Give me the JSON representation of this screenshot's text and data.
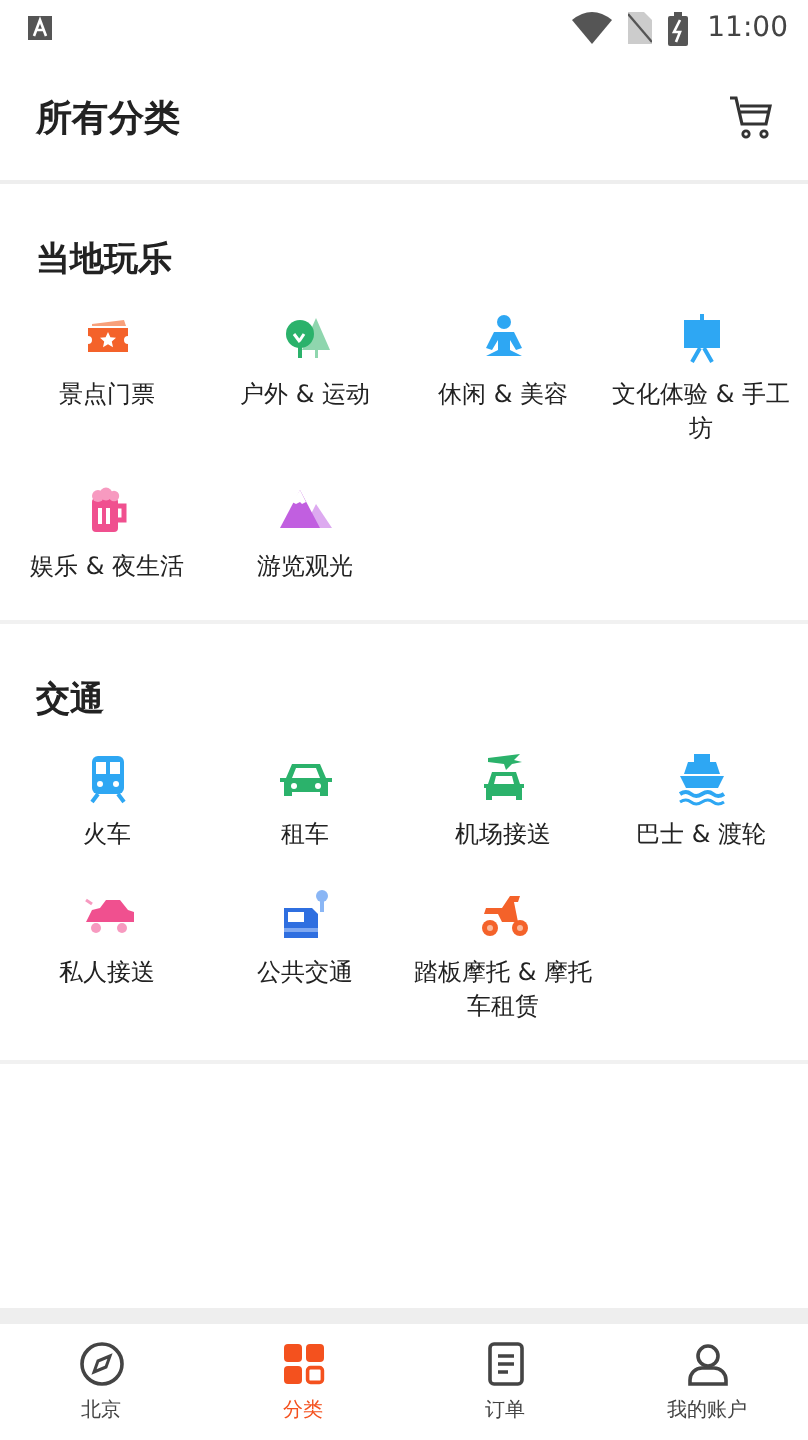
{
  "status_bar": {
    "time": "11:00"
  },
  "header": {
    "title": "所有分类"
  },
  "sections": [
    {
      "title": "当地玩乐",
      "items": [
        {
          "label": "景点门票"
        },
        {
          "label": "户外 & 运动"
        },
        {
          "label": "休闲 & 美容"
        },
        {
          "label": "文化体验 & 手工坊"
        },
        {
          "label": "娱乐 & 夜生活"
        },
        {
          "label": "游览观光"
        }
      ]
    },
    {
      "title": "交通",
      "items": [
        {
          "label": "火车"
        },
        {
          "label": "租车"
        },
        {
          "label": "机场接送"
        },
        {
          "label": "巴士 & 渡轮"
        },
        {
          "label": "私人接送"
        },
        {
          "label": "公共交通"
        },
        {
          "label": "踏板摩托 & 摩托车租赁"
        }
      ]
    }
  ],
  "tab_bar": [
    {
      "label": "北京",
      "selected": false
    },
    {
      "label": "分类",
      "selected": true
    },
    {
      "label": "订单",
      "selected": false
    },
    {
      "label": "我的账户",
      "selected": false
    }
  ]
}
